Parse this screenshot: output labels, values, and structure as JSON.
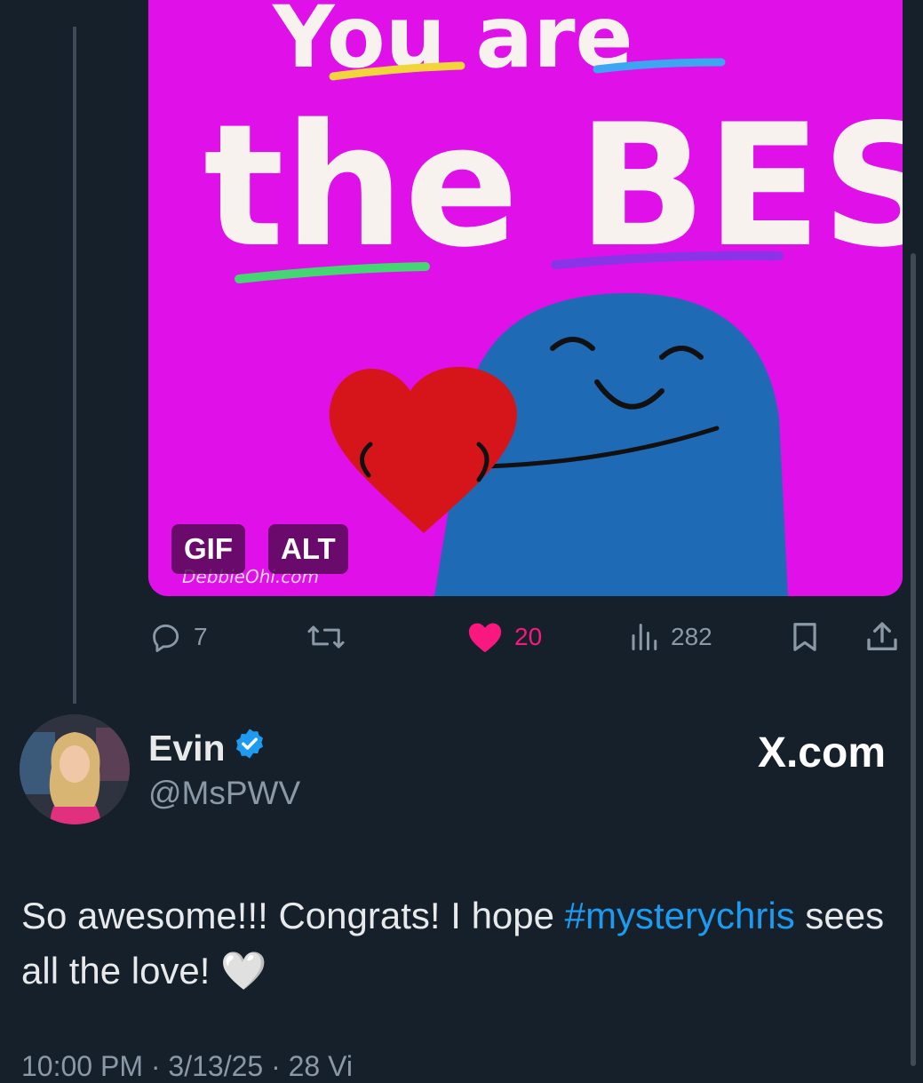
{
  "media": {
    "gif_label": "GIF",
    "alt_label": "ALT",
    "image_text_top": "You are",
    "image_text_main": "the BEST.",
    "watermark": "DebbieOhi.com",
    "background_color": "#df10e8"
  },
  "actions": {
    "replies": "7",
    "retweets": "",
    "likes": "20",
    "views": "282",
    "like_color": "#f91880"
  },
  "reply": {
    "name": "Evin",
    "handle": "@MsPWV",
    "verified": true,
    "brand": "X.com",
    "text_before": "So awesome!!! Congrats! I hope ",
    "hashtag": "#mysterychris",
    "text_after": " sees all the love! ",
    "emoji": "🤍",
    "hashtag_color": "#1d9bf0"
  },
  "footer": {
    "partial_text": "10:00 PM · 3/13/25 · 28 Vi"
  }
}
